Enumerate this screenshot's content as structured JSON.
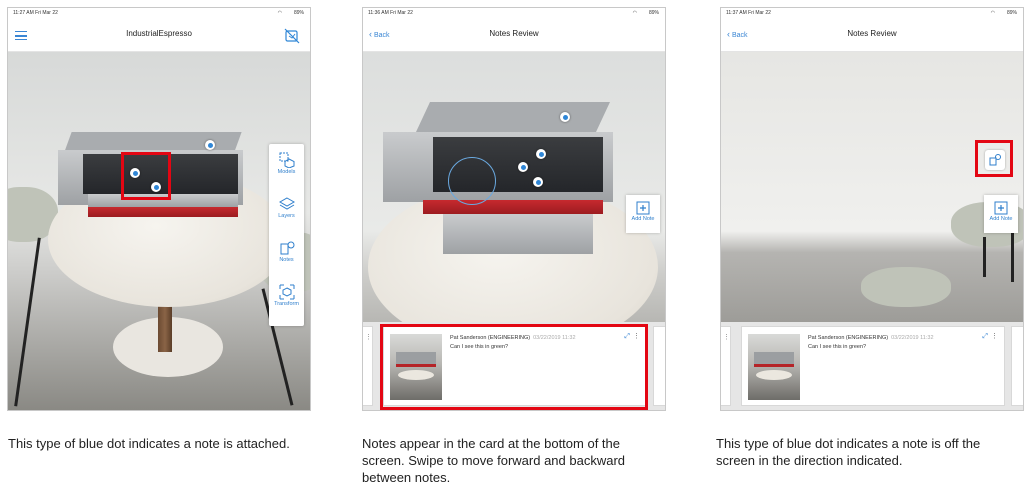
{
  "panels": [
    {
      "status_time": "11:27 AM  Fri Mar 22",
      "status_battery": "89%",
      "title": "IndustrialEspresso",
      "toolbar": [
        {
          "label": "Models",
          "icon": "models-icon"
        },
        {
          "label": "Layers",
          "icon": "layers-icon"
        },
        {
          "label": "Notes",
          "icon": "notes-icon"
        },
        {
          "label": "Transform",
          "icon": "transform-icon"
        }
      ],
      "caption": "This type of blue dot indicates a note is attached."
    },
    {
      "status_time": "11:36 AM  Fri Mar 22",
      "status_battery": "89%",
      "back_label": "Back",
      "title": "Notes Review",
      "add_note_label": "Add Note",
      "note": {
        "author": "Pat Sanderson (ENGINEERING)",
        "date": "03/22/2019 11:32",
        "text": "Can I see this in green?"
      },
      "caption": "Notes appear in the card at the bottom of the screen. Swipe to move forward and backward between notes."
    },
    {
      "status_time": "11:37 AM  Fri Mar 22",
      "status_battery": "89%",
      "back_label": "Back",
      "title": "Notes Review",
      "add_note_label": "Add Note",
      "note": {
        "author": "Pat Sanderson (ENGINEERING)",
        "date": "03/22/2019 11:32",
        "text": "Can I see this in green?"
      },
      "caption": "This type of blue dot indicates a note is off the screen in the direction indicated."
    }
  ],
  "colors": {
    "accent": "#2f86d6",
    "highlight": "#e30613"
  }
}
